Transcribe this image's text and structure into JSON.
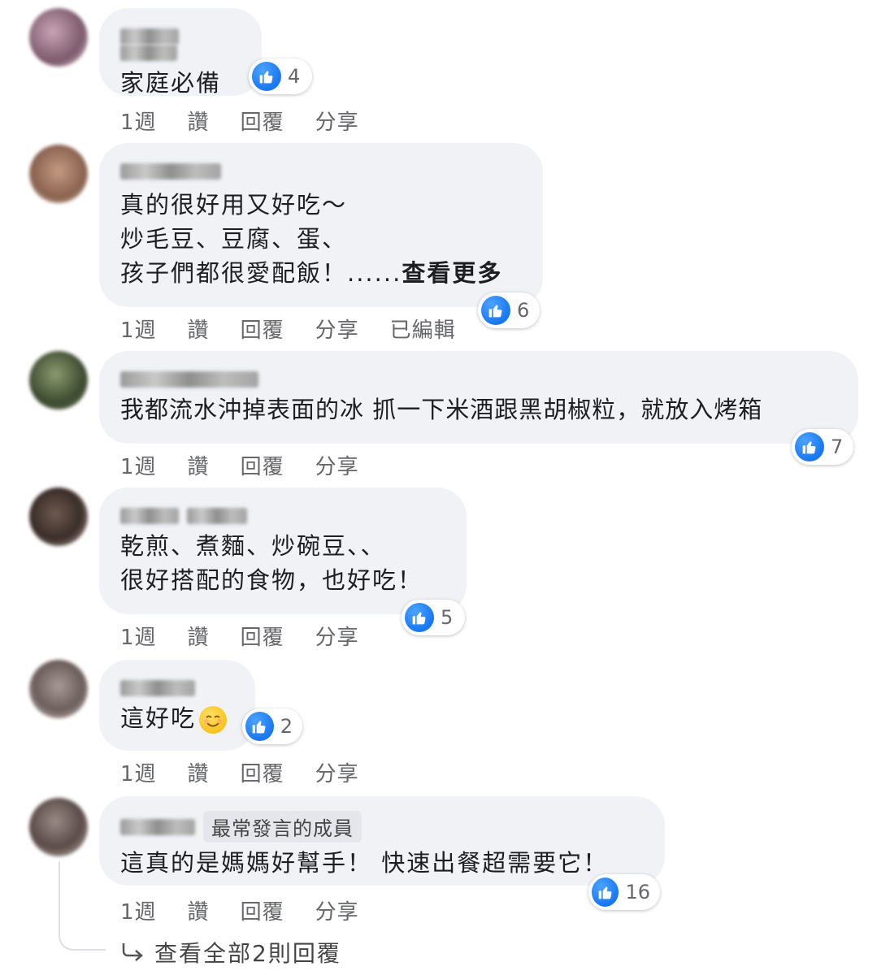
{
  "actions": {
    "time": "1週",
    "like": "讚",
    "reply": "回覆",
    "share": "分享"
  },
  "like_icon": "thumbs-up-icon",
  "accent": "#1877f2",
  "comments": [
    {
      "text": "家庭必備",
      "reactions": "4",
      "edited": ""
    },
    {
      "text": "真的很好用又好吃～\n炒毛豆、豆腐、蛋、\n孩子們都很愛配飯！......",
      "see_more": "查看更多",
      "reactions": "6",
      "edited": "已編輯"
    },
    {
      "text": "我都流水沖掉表面的冰 抓一下米酒跟黑胡椒粒，就放入烤箱",
      "reactions": "7"
    },
    {
      "text": "乾煎、煮麵、炒碗豆、、\n很好搭配的食物，也好吃！",
      "reactions": "5"
    },
    {
      "text": "這好吃",
      "emoji": "smiling-face-emoji",
      "reactions": "2"
    },
    {
      "badge": "最常發言的成員",
      "text": "這真的是媽媽好幫手！ 快速出餐超需要它！",
      "reactions": "16"
    }
  ],
  "view_replies": "查看全部2則回覆"
}
